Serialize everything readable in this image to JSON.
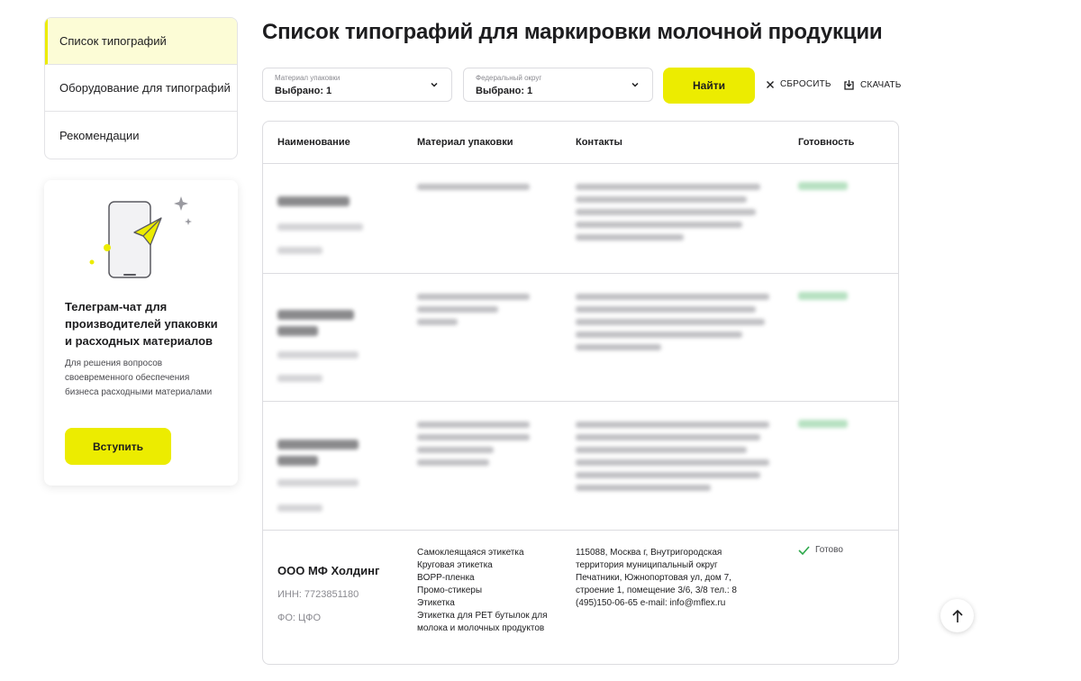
{
  "sidebar": {
    "items": [
      {
        "label": "Список типографий",
        "active": true
      },
      {
        "label": "Оборудование для типографий",
        "active": false
      },
      {
        "label": "Рекомендации",
        "active": false
      }
    ]
  },
  "promo": {
    "title": "Телеграм-чат для производителей упаковки и расходных материалов",
    "description": "Для решения вопросов своевременного обеспечения бизнеса расходными материалами",
    "button_label": "Вступить",
    "icons": [
      "phone-illustration",
      "paper-plane-icon",
      "sparkle-icon"
    ]
  },
  "page": {
    "title": "Список типографий для маркировки молочной продукции"
  },
  "filters": {
    "material": {
      "label": "Материал упаковки",
      "value": "Выбрано: 1"
    },
    "district": {
      "label": "Федеральный округ",
      "value": "Выбрано: 1"
    },
    "find_label": "Найти",
    "reset_label": "СБРОСИТЬ",
    "download_label": "СКАЧАТЬ"
  },
  "table": {
    "headers": [
      "Наименование",
      "Материал упаковки",
      "Контакты",
      "Готовность"
    ],
    "rows": [
      {
        "name": "ООО МФ Холдинг",
        "inn": "ИНН: 7723851180",
        "fo": "ФО: ЦФО",
        "materials": [
          "Самоклеящаяся этикетка",
          "Круговая этикетка",
          "BOPP-пленка",
          "Промо-стикеры",
          "Этикетка",
          "Этикетка для PET бутылок для молока и молочных продуктов"
        ],
        "contacts": "115088, Москва г, Внутригородская территория муниципальный округ Печатники, Южнопортовая ул, дом 7, строение 1, помещение 3/6, 3/8 тел.: 8 (495)150-06-65 e-mail: info@mflex.ru",
        "readiness": "Готово"
      }
    ]
  },
  "colors": {
    "accent": "#ecec00",
    "active_bg": "#fcfcd6",
    "border": "#dcdce0",
    "ready_green": "#2ca84a"
  }
}
